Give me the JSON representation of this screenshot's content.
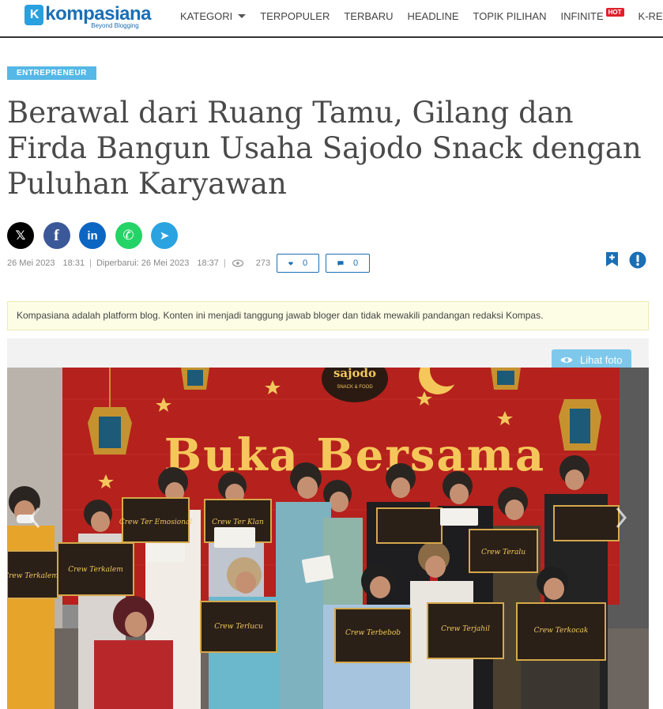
{
  "nav": {
    "logo_mark": "K",
    "logo_name": "kompasiana",
    "logo_tag": "Beyond Blogging",
    "items": [
      {
        "label": "KATEGORI",
        "dropdown": true
      },
      {
        "label": "TERPOPULER"
      },
      {
        "label": "TERBARU"
      },
      {
        "label": "HEADLINE"
      },
      {
        "label": "TOPIK PILIHAN"
      },
      {
        "label": "INFINITE",
        "badge": "HOT"
      },
      {
        "label": "K-REWARD"
      }
    ]
  },
  "article": {
    "category": "ENTREPRENEUR",
    "title": "Berawal dari Ruang Tamu, Gilang dan Firda Bangun Usaha Sajodo Snack dengan Puluhan Karyawan",
    "published_date": "26 Mei 2023",
    "published_time": "18:31",
    "updated_label": "Diperbarui: 26 Mei 2023",
    "updated_time": "18:37",
    "views": "273",
    "likes": "0",
    "comments": "0"
  },
  "share": [
    {
      "icon": "x-twitter-icon",
      "glyph": "𝕏",
      "color": "#000000"
    },
    {
      "icon": "facebook-icon",
      "glyph": "f",
      "color": "#3b5998"
    },
    {
      "icon": "linkedin-icon",
      "glyph": "in",
      "color": "#0a66c2"
    },
    {
      "icon": "whatsapp-icon",
      "glyph": "✆",
      "color": "#25d366"
    },
    {
      "icon": "telegram-icon",
      "glyph": "➤",
      "color": "#2aa3e0"
    }
  ],
  "notice": "Kompasiana adalah platform blog. Konten ini menjadi tanggung jawab bloger dan tidak mewakili pandangan redaksi Kompas.",
  "photo": {
    "button_label": "Lihat foto",
    "banner_brand": "sajodo",
    "banner_brand_sub": "SNACK & FOOD",
    "banner_text": "Buka Bersama",
    "cards": [
      "Crew Ter Emosional",
      "Crew Ter Klan",
      "Crew Terkalem",
      "Crew Terkalem",
      "Crew Terlucu",
      "Crew Terbebob",
      "Crew Terjahil",
      "Crew Terkocak",
      "Crew Teralu"
    ]
  },
  "colors": {
    "brand": "#1a6fb5",
    "badge": "#55b8e6",
    "notice_bg": "#fdfde5",
    "banner_red": "#b5211d"
  }
}
